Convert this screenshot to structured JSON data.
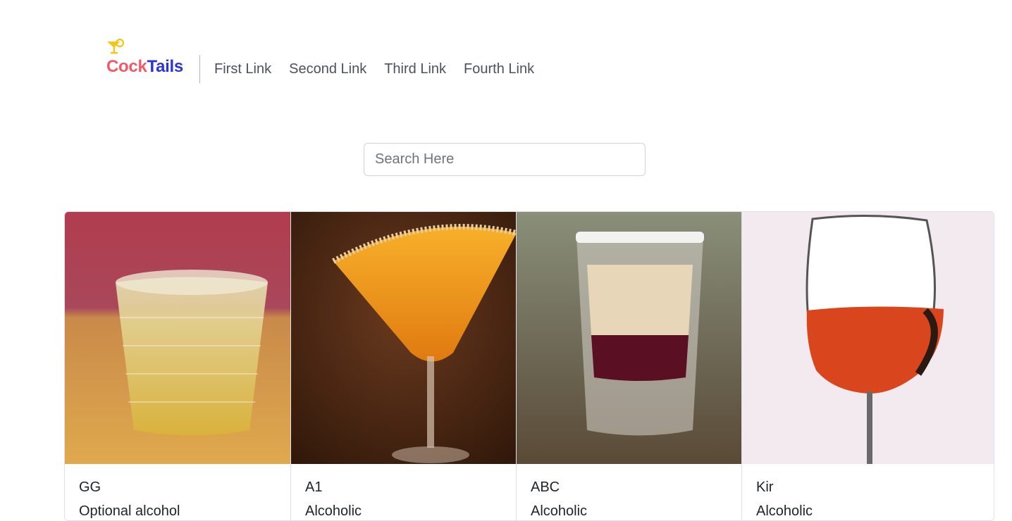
{
  "header": {
    "brand_part1": "Cock",
    "brand_part2": "Tails",
    "brand_icon": "cocktail-glass-icon",
    "links": [
      "First Link",
      "Second Link",
      "Third Link",
      "Fourth Link"
    ]
  },
  "search": {
    "placeholder": "Search Here",
    "value": ""
  },
  "cards": [
    {
      "title": "GG",
      "subtitle": "Optional alcohol",
      "image": "tumbler-glass-yellow-drink"
    },
    {
      "title": "A1",
      "subtitle": "Alcoholic",
      "image": "martini-glass-orange-drink"
    },
    {
      "title": "ABC",
      "subtitle": "Alcoholic",
      "image": "shot-glass-layered-drink"
    },
    {
      "title": "Kir",
      "subtitle": "Alcoholic",
      "image": "wine-glass-red-drink"
    }
  ],
  "colors": {
    "brand_red": "#f05a67",
    "brand_blue": "#2c34d8",
    "icon_yellow": "#f5c518",
    "nav_text": "#4a5160"
  }
}
